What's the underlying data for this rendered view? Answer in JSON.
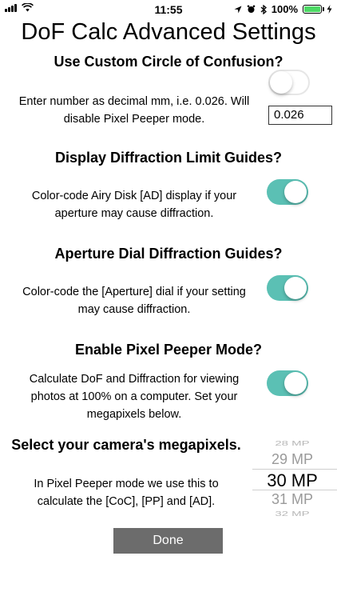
{
  "status_bar": {
    "time": "11:55",
    "battery": "100%",
    "battery_level": 1.0,
    "battery_color": "#4cd964"
  },
  "page_title": "DoF Calc Advanced Settings",
  "sections": {
    "custom_coc": {
      "heading": "Use Custom Circle of Confusion?",
      "desc_line1": "Enter number as decimal mm, i.e. 0.026. Will",
      "desc_line2": "disable Pixel Peeper mode.",
      "toggle_on": false,
      "input_value": "0.026"
    },
    "diffraction_limit": {
      "heading": "Display Diffraction Limit Guides?",
      "desc_line1": "Color-code Airy Disk [AD] display if your",
      "desc_line2": "aperture may cause diffraction.",
      "toggle_on": true
    },
    "aperture_dial": {
      "heading": "Aperture Dial Diffraction Guides?",
      "desc_line1": "Color-code the [Aperture] dial if your setting",
      "desc_line2": "may cause diffraction.",
      "toggle_on": true
    },
    "pixel_peeper": {
      "heading": "Enable Pixel Peeper Mode?",
      "desc_line1": "Calculate DoF and Diffraction for viewing",
      "desc_line2": "photos at 100% on a computer. Set your",
      "desc_line3": "megapixels below.",
      "toggle_on": true
    },
    "megapixels": {
      "heading": "Select your camera's megapixels.",
      "desc_line1": "In Pixel Peeper mode we use this to",
      "desc_line2": "calculate the [CoC], [PP] and [AD].",
      "picker_items": [
        "28 MP",
        "29 MP",
        "30 MP",
        "31 MP",
        "32 MP"
      ],
      "selected": "30 MP"
    }
  },
  "done_label": "Done",
  "colors": {
    "toggle_on": "#5bc0b4",
    "done_button": "#6c6c6c"
  },
  "icons": [
    "signal-icon",
    "wifi-icon",
    "location-icon",
    "alarm-icon",
    "bluetooth-icon",
    "battery-icon",
    "charging-icon"
  ]
}
